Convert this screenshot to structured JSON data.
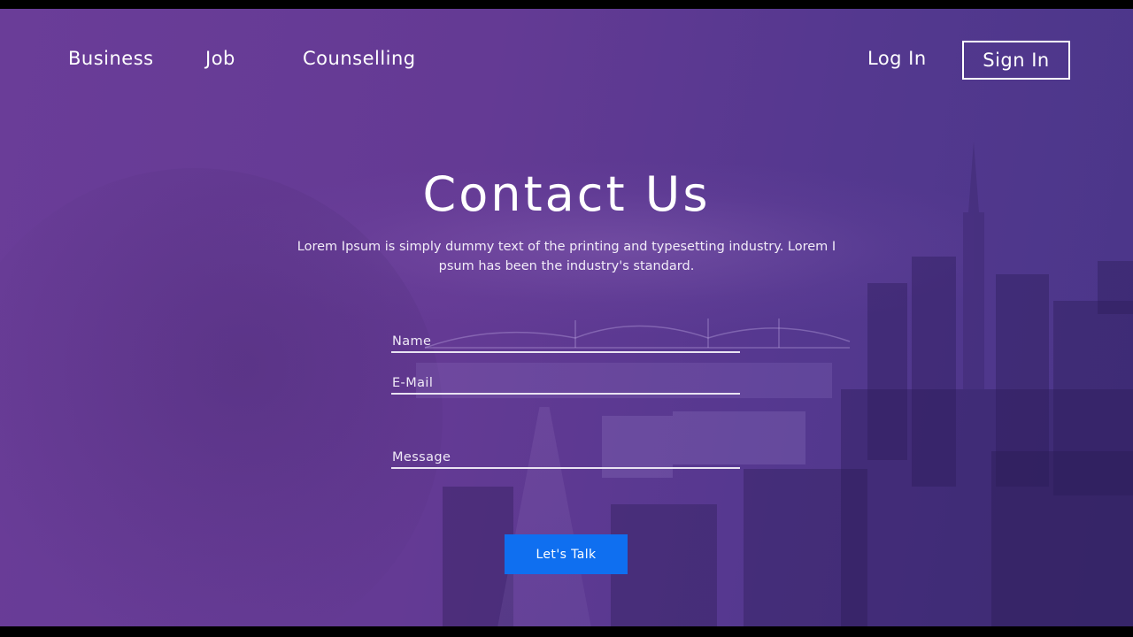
{
  "nav": {
    "links": [
      "Business",
      "Job",
      "Counselling"
    ],
    "login_label": "Log In",
    "signin_label": "Sign In"
  },
  "hero": {
    "title": "Contact Us",
    "subtitle_line1": "Lorem Ipsum is simply dummy text of the printing and typesetting industry. Lorem I",
    "subtitle_line2": "psum has been the industry's standard."
  },
  "form": {
    "name_placeholder": "Name",
    "email_placeholder": "E-Mail",
    "message_placeholder": "Message",
    "submit_label": "Let's Talk"
  },
  "colors": {
    "background_overlay": "#643a94",
    "button": "#0f6ff0",
    "text": "#ffffff"
  }
}
